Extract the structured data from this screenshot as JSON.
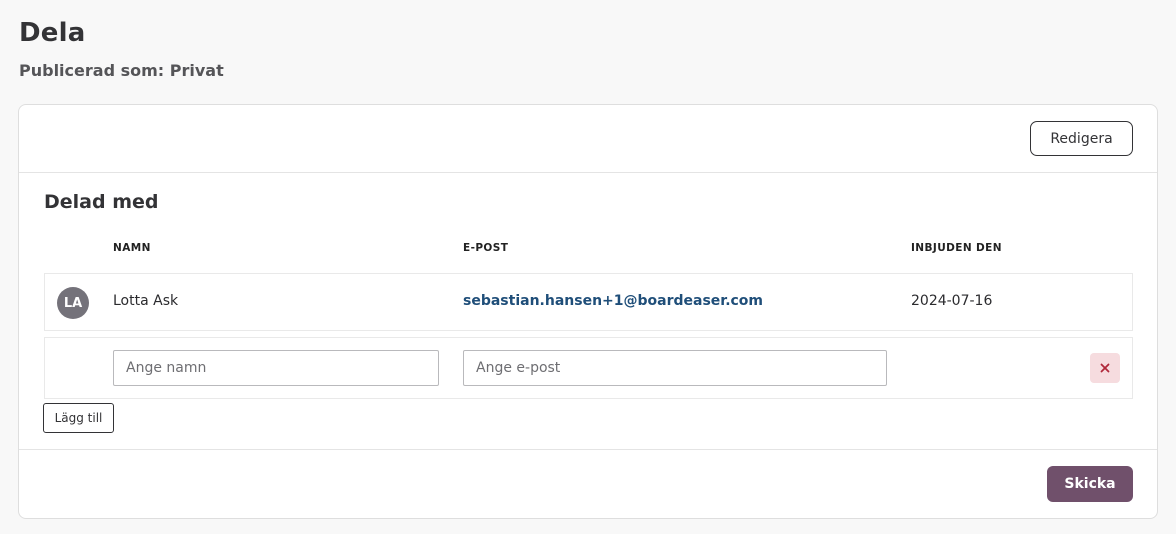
{
  "page": {
    "title": "Dela",
    "subtitle": "Publicerad som: Privat"
  },
  "toolbar": {
    "edit_label": "Redigera"
  },
  "shared": {
    "section_title": "Delad med",
    "columns": {
      "name": "NAMN",
      "email": "E-POST",
      "invited": "INBJUDEN DEN"
    },
    "rows": [
      {
        "initials": "LA",
        "name": "Lotta Ask",
        "email": "sebastian.hansen+1@boardeaser.com",
        "invited": "2024-07-16"
      }
    ],
    "new_row": {
      "name_placeholder": "Ange namn",
      "email_placeholder": "Ange e-post",
      "name_value": "",
      "email_value": "",
      "remove_icon": "close-icon"
    },
    "add_label": "Lägg till"
  },
  "footer": {
    "send_label": "Skicka"
  },
  "colors": {
    "primary": "#70506b",
    "link": "#1f4e79",
    "danger_bg": "#f6dcdf",
    "danger": "#b0283a",
    "avatar_bg": "#74727a"
  }
}
